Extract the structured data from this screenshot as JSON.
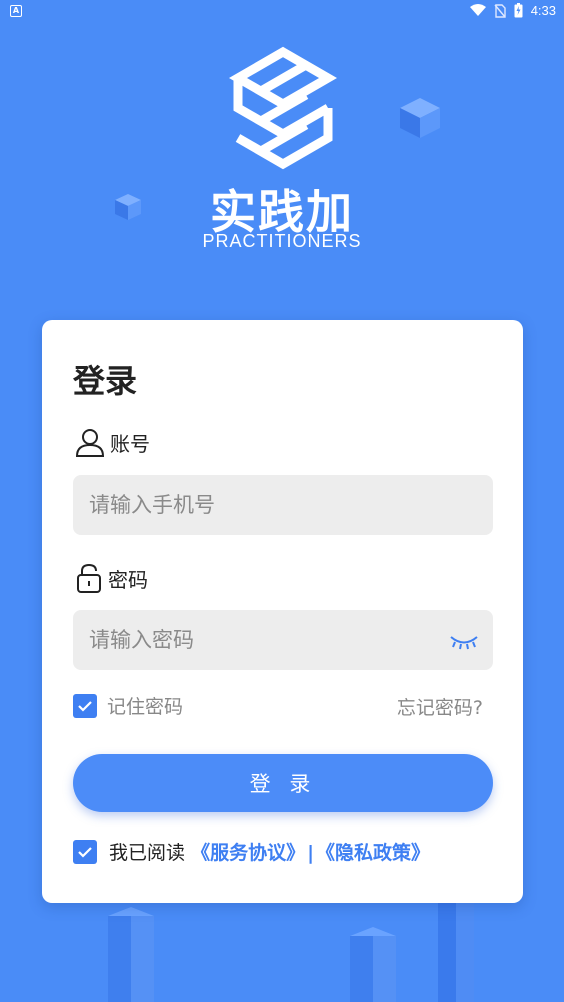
{
  "status_bar": {
    "time": "4:33",
    "notification": "A"
  },
  "brand": {
    "name_cn": "实践加",
    "name_en": "PRACTITIONERS"
  },
  "login": {
    "title": "登录",
    "account_label": "账号",
    "account_placeholder": "请输入手机号",
    "password_label": "密码",
    "password_placeholder": "请输入密码",
    "remember_label": "记住密码",
    "remember_checked": true,
    "forgot_label": "忘记密码?",
    "submit_label": "登 录",
    "agree_prefix": "我已阅读",
    "service_link": "《服务协议》",
    "separator": "|",
    "privacy_link": "《隐私政策》",
    "agree_checked": true
  },
  "colors": {
    "background": "#4a8cf7",
    "accent": "#3e7ff2",
    "card": "#ffffff",
    "input_bg": "#ededed"
  }
}
